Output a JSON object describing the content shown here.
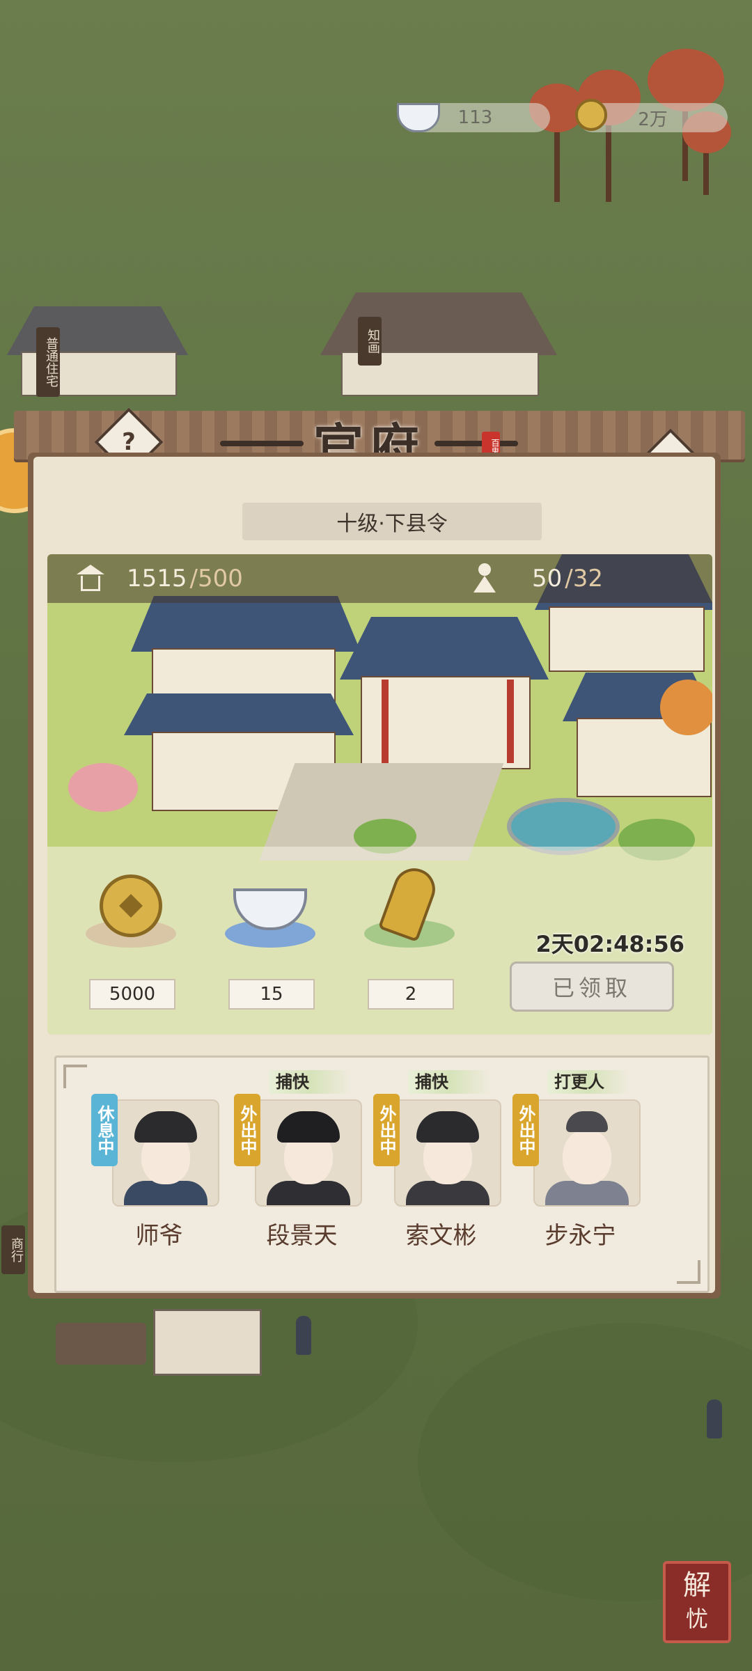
{
  "currency": {
    "silver_value": "113",
    "coin_value": "2万"
  },
  "panel": {
    "title": "官府",
    "seal_text": "百鬼",
    "rank_text": "十级·下县令",
    "help_label": "?",
    "stats": {
      "building_current": "1515",
      "building_max": "/500",
      "people_current": "50",
      "people_max": "/32"
    },
    "rewards": [
      {
        "icon": "coin-icon",
        "value": "5000"
      },
      {
        "icon": "silver-ingot-icon",
        "value": "15"
      },
      {
        "icon": "token-icon",
        "value": "2"
      }
    ],
    "timer": "2天02:48:56",
    "claim_label": "已领取"
  },
  "staff": [
    {
      "name": "师爷",
      "status": "休息中",
      "status_color": "#5ab4d6",
      "role": ""
    },
    {
      "name": "段景天",
      "status": "外出中",
      "status_color": "#d9a52c",
      "role": "捕快"
    },
    {
      "name": "索文彬",
      "status": "外出中",
      "status_color": "#d9a52c",
      "role": "捕快"
    },
    {
      "name": "步永宁",
      "status": "外出中",
      "status_color": "#d9a52c",
      "role": "打更人"
    }
  ],
  "side_labels": {
    "left_top": "普通住宅",
    "mid_top": "知画",
    "left_bottom": "商行"
  },
  "bottom_button": {
    "line1": "解",
    "line2": "忧"
  }
}
